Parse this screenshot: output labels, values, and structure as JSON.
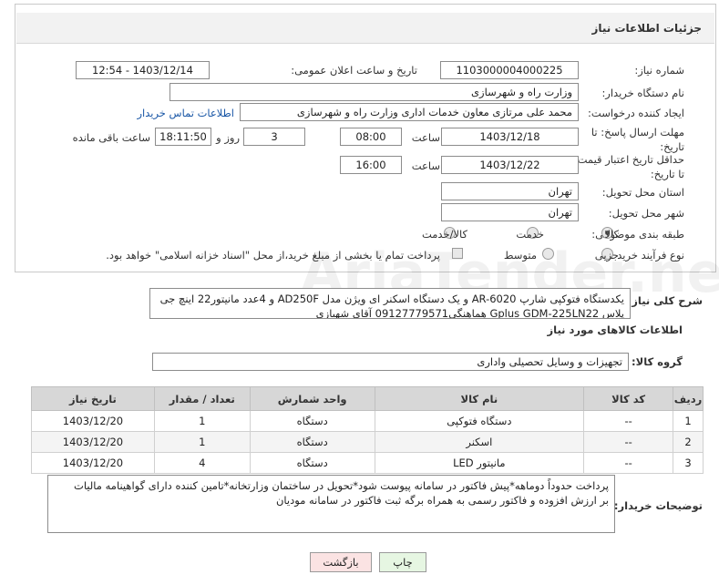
{
  "header": {
    "title": "جزئیات اطلاعات نیاز"
  },
  "form": {
    "need_number_label": "شماره نیاز:",
    "need_number": "1103000004000225",
    "announce_label": "تاریخ و ساعت اعلان عمومی:",
    "announce_value": "1403/12/14 - 12:54",
    "buyer_org_label": "نام دستگاه خریدار:",
    "buyer_org": "وزارت راه و شهرسازی",
    "creator_label": "ایجاد کننده درخواست:",
    "creator": "محمد علی  مرتازی معاون خدمات اداری وزارت راه و شهرسازی",
    "contact_link": "اطلاعات تماس خریدار",
    "send_deadline_label": "مهلت ارسال پاسخ: تا تاریخ:",
    "send_date": "1403/12/18",
    "time_label": "ساعت",
    "send_time": "08:00",
    "days_value": "3",
    "days_label": "روز و",
    "remaining_time": "18:11:50",
    "remaining_label": "ساعت باقی مانده",
    "price_valid_label": "حداقل تاریخ اعتبار قیمت: تا تاریخ:",
    "price_date": "1403/12/22",
    "price_time": "16:00",
    "province_label": "استان محل تحویل:",
    "province": "تهران",
    "city_label": "شهر محل تحویل:",
    "city": "تهران",
    "category_label": "طبقه بندی موضوعی:",
    "category_options": [
      "کالا",
      "خدمت",
      "کالا/خدمت"
    ],
    "process_label": "نوع فرآیند خرید :",
    "process_options": [
      "جزیی",
      "متوسط"
    ],
    "payment_note": "پرداخت تمام یا بخشی از مبلغ خرید،از محل \"اسناد خزانه اسلامی\" خواهد بود."
  },
  "summary": {
    "label": "شرح کلی نیاز:",
    "line1": "یکدستگاه فتوکپی شارپ AR-6020 و یک دستگاه اسکنر ای ویژن مدل AD250F و 4عدد مانیتور22 اینچ جی",
    "line2": "پلاس Gplus GDM-225LN22 هماهنگی09127779571 آقای شهبازی"
  },
  "goods": {
    "section_title": "اطلاعات کالاهای مورد نیاز",
    "group_label": "گروه کالا:",
    "group_value": "تجهیزات و وسایل تحصیلی واداری",
    "columns": [
      "ردیف",
      "کد کالا",
      "نام کالا",
      "واحد شمارش",
      "تعداد / مقدار",
      "تاریخ نیاز"
    ],
    "rows": [
      [
        "1",
        "--",
        "دستگاه فتوکپی",
        "دستگاه",
        "1",
        "1403/12/20"
      ],
      [
        "2",
        "--",
        "اسکنر",
        "دستگاه",
        "1",
        "1403/12/20"
      ],
      [
        "3",
        "--",
        "مانیتور LED",
        "دستگاه",
        "4",
        "1403/12/20"
      ]
    ]
  },
  "buyer_notes": {
    "label": "توضیحات خریدار:",
    "line1": "پرداخت حدوداً دوماهه*پیش فاکتور در سامانه پیوست شود*تحویل در ساختمان وزارتخانه*تامین کننده دارای گواهینامه مالیات",
    "line2": "بر ارزش افزوده و فاکتور رسمی به همراه برگه ثبت فاکتور در سامانه مودیان"
  },
  "buttons": {
    "print": "چاپ",
    "back": "بازگشت"
  },
  "colors": {
    "link": "#1a57a6",
    "print_bg": "#e6f6e2",
    "back_bg": "#fbe3e3"
  }
}
